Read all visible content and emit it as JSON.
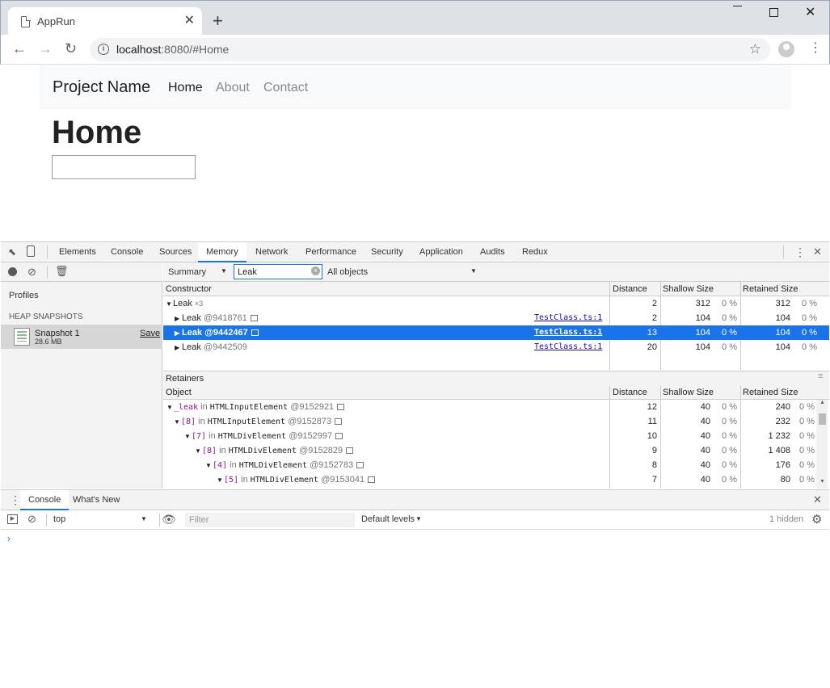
{
  "browser": {
    "tab_title": "AppRun",
    "url_host": "localhost",
    "url_rest": ":8080/#Home"
  },
  "page": {
    "brand": "Project Name",
    "nav": [
      "Home",
      "About",
      "Contact"
    ],
    "heading": "Home",
    "input_value": ""
  },
  "devtools": {
    "tabs": [
      "Elements",
      "Console",
      "Sources",
      "Memory",
      "Network",
      "Performance",
      "Security",
      "Application",
      "Audits",
      "Redux"
    ],
    "active_tab": "Memory",
    "profiles_label": "Profiles",
    "heap_snapshots_label": "HEAP SNAPSHOTS",
    "snapshot": {
      "name": "Snapshot 1",
      "size": "28.6 MB",
      "save_label": "Save"
    },
    "view_select": "Summary",
    "class_filter": "Leak",
    "objects_select": "All objects",
    "constructor_headers": [
      "Constructor",
      "Distance",
      "Shallow Size",
      "Retained Size"
    ],
    "constructor_rows": [
      {
        "name": "Leak",
        "suffix": "×3",
        "link": "",
        "distance": "2",
        "shallow": "312",
        "shallow_pct": "0 %",
        "retained": "312",
        "retained_pct": "0 %"
      },
      {
        "name": "Leak",
        "suffix": "@9418761",
        "link": "TestClass.ts:1",
        "distance": "2",
        "shallow": "104",
        "shallow_pct": "0 %",
        "retained": "104",
        "retained_pct": "0 %"
      },
      {
        "name": "Leak",
        "suffix": "@9442467",
        "link": "TestClass.ts:1",
        "distance": "13",
        "shallow": "104",
        "shallow_pct": "0 %",
        "retained": "104",
        "retained_pct": "0 %"
      },
      {
        "name": "Leak",
        "suffix": "@9442509",
        "link": "TestClass.ts:1",
        "distance": "20",
        "shallow": "104",
        "shallow_pct": "0 %",
        "retained": "104",
        "retained_pct": "0 %"
      }
    ],
    "retainers_label": "Retainers",
    "retainer_headers": [
      "Object",
      "Distance",
      "Shallow Size",
      "Retained Size"
    ],
    "retainer_rows": [
      {
        "key": "_leak",
        "in": "in",
        "type": "HTMLInputElement",
        "id": "@9152921",
        "distance": "12",
        "shallow": "40",
        "shallow_pct": "0 %",
        "retained": "240",
        "retained_pct": "0 %"
      },
      {
        "key": "[8]",
        "in": "in",
        "type": "HTMLInputElement",
        "id": "@9152873",
        "distance": "11",
        "shallow": "40",
        "shallow_pct": "0 %",
        "retained": "232",
        "retained_pct": "0 %"
      },
      {
        "key": "[7]",
        "in": "in",
        "type": "HTMLDivElement",
        "id": "@9152997",
        "distance": "10",
        "shallow": "40",
        "shallow_pct": "0 %",
        "retained": "1 232",
        "retained_pct": "0 %"
      },
      {
        "key": "[8]",
        "in": "in",
        "type": "HTMLDivElement",
        "id": "@9152829",
        "distance": "9",
        "shallow": "40",
        "shallow_pct": "0 %",
        "retained": "1 408",
        "retained_pct": "0 %"
      },
      {
        "key": "[4]",
        "in": "in",
        "type": "HTMLDivElement",
        "id": "@9152783",
        "distance": "8",
        "shallow": "40",
        "shallow_pct": "0 %",
        "retained": "176",
        "retained_pct": "0 %"
      },
      {
        "key": "[5]",
        "in": "in",
        "type": "HTMLDivElement",
        "id": "@9153041",
        "distance": "7",
        "shallow": "40",
        "shallow_pct": "0 %",
        "retained": "80",
        "retained_pct": "0 %"
      }
    ],
    "drawer_tabs": [
      "Console",
      "What's New"
    ],
    "context": "top",
    "filter_placeholder": "Filter",
    "levels": "Default levels",
    "hidden_count": "1 hidden",
    "prompt": "›"
  },
  "colors": {
    "selection": "#1a73e8",
    "link": "#1a0dab",
    "property": "#881391"
  }
}
